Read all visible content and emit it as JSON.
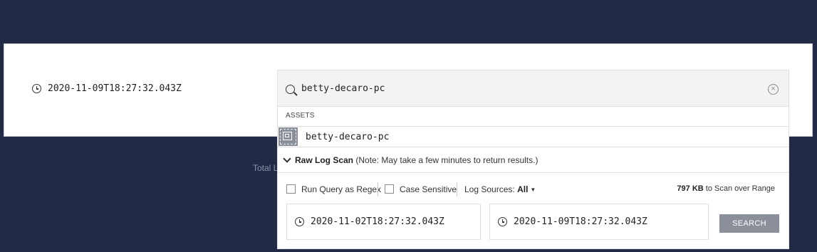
{
  "selected_time": "2020-11-09T18:27:32.043Z",
  "background_text": "Total L",
  "search": {
    "query": "betty-decaro-pc",
    "clear_icon": "clear-circle-icon"
  },
  "dropdown": {
    "assets_header": "ASSETS",
    "asset_items": [
      {
        "label": "betty-decaro-pc",
        "icon": "asset-chip-icon"
      }
    ],
    "raw_log_scan": {
      "title": "Raw Log Scan",
      "note": "(Note: May take a few minutes to return results.)",
      "options": {
        "regex_label": "Run Query as Regex",
        "regex_checked": false,
        "case_label": "Case Sensitive",
        "case_checked": false,
        "sources_label": "Log Sources:",
        "sources_value": "All"
      },
      "scan_size": "797 KB",
      "scan_size_suffix": "to Scan over Range",
      "start_time": "2020-11-02T18:27:32.043Z",
      "end_time": "2020-11-09T18:27:32.043Z",
      "search_button": "SEARCH"
    }
  },
  "colors": {
    "background": "#222b45",
    "button": "#8a8f99"
  }
}
